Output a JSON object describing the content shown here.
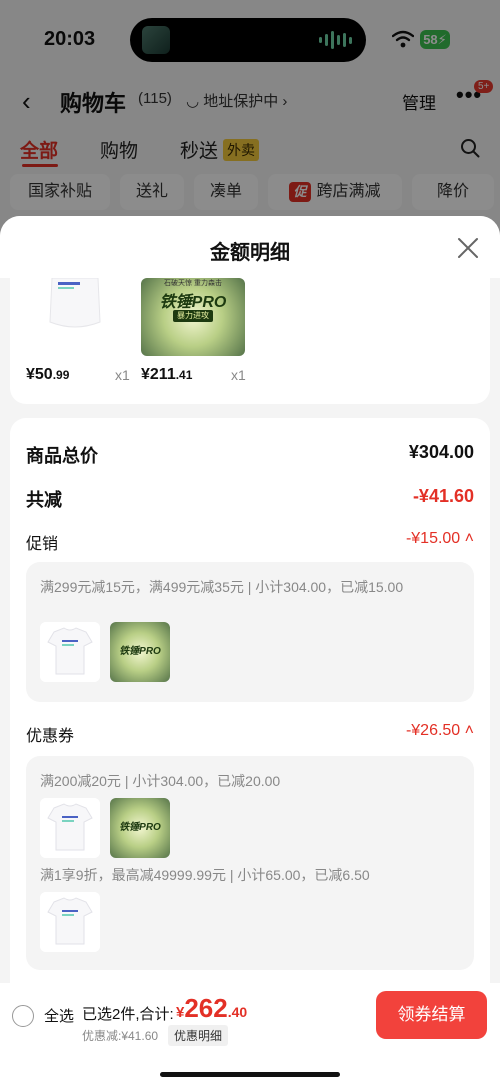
{
  "status_bar": {
    "time": "20:03",
    "battery": "58"
  },
  "nav": {
    "back": "‹",
    "title": "购物车",
    "count": "(115)",
    "address_protect": "地址保护中 ›",
    "manage": "管理",
    "more": "•••",
    "badge": "5+"
  },
  "tabs": [
    {
      "label": "全部"
    },
    {
      "label": "购物"
    },
    {
      "label": "秒送"
    }
  ],
  "takeout_tag": "外卖",
  "chips": [
    {
      "label": "国家补贴"
    },
    {
      "label": "送礼"
    },
    {
      "label": "凑单"
    },
    {
      "label": "跨店满减"
    },
    {
      "label": "降价"
    }
  ],
  "chip_promo_tag": "促",
  "sheet": {
    "title": "金额明细"
  },
  "products": [
    {
      "price_main": "¥50",
      "price_dec": ".99",
      "qty": "x1"
    },
    {
      "price_main": "¥211",
      "price_dec": ".41",
      "qty": "x1"
    }
  ],
  "racket_label": {
    "line1": "石破天惊 重力森击",
    "line2": "铁锤PRO",
    "line3": "暴力进攻"
  },
  "summary": {
    "goods_total_label": "商品总价",
    "goods_total": "¥304.00",
    "reduce_label": "共减",
    "reduce": "-¥41.60",
    "promo_label": "促销",
    "promo": "-¥15.00 ˄",
    "promo_detail": "满299元减15元，满499元减35元 | 小计304.00，已减15.00",
    "coupon_label": "优惠券",
    "coupon": "-¥26.50 ˄",
    "coupon_detail_1": "满200减20元 | 小计304.00，已减20.00",
    "coupon_detail_2": "满1享9折，最高减49999.99元 | 小计65.00，已减6.50"
  },
  "footer": {
    "select_all": "全选",
    "selected_info": "已选2件,合计:",
    "total_cur": "¥",
    "total_int": "262",
    "total_dec": ".40",
    "discount": "优惠减:¥41.60",
    "detail_tag": "优惠明细",
    "checkout": "领券结算"
  },
  "colors": {
    "accent": "#e33026",
    "checkout": "#f2423c",
    "takeout": "#f5cb3d"
  }
}
